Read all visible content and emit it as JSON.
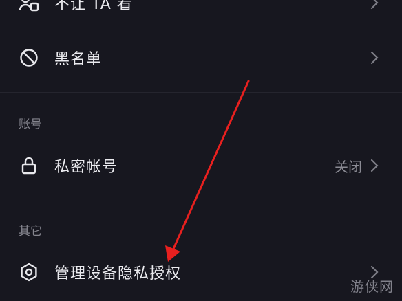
{
  "rows": [
    {
      "label": "不让 TA 看",
      "icon": "users-hidden-icon"
    },
    {
      "label": "黑名单",
      "icon": "block-icon"
    }
  ],
  "sections": {
    "account": {
      "title": "账号",
      "items": [
        {
          "label": "私密帐号",
          "value": "关闭",
          "icon": "lock-icon"
        }
      ]
    },
    "other": {
      "title": "其它",
      "items": [
        {
          "label": "管理设备隐私授权",
          "icon": "hexagon-settings-icon"
        }
      ]
    }
  },
  "colors": {
    "background": "#17171f",
    "annotation_arrow": "#e8201f"
  },
  "watermark": "游侠网"
}
